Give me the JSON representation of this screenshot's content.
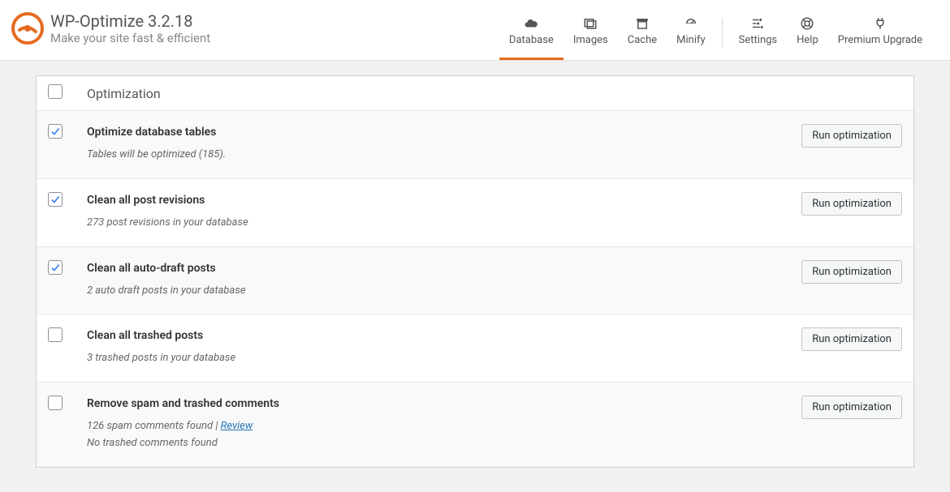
{
  "brand": {
    "title": "WP-Optimize 3.2.18",
    "tagline": "Make your site fast & efficient"
  },
  "nav": {
    "database": "Database",
    "images": "Images",
    "cache": "Cache",
    "minify": "Minify",
    "settings": "Settings",
    "help": "Help",
    "premium": "Premium Upgrade"
  },
  "table": {
    "header": "Optimization",
    "run_label": "Run optimization",
    "review_label": "Review",
    "rows": [
      {
        "title": "Optimize database tables",
        "desc": "Tables will be optimized (185).",
        "checked": true
      },
      {
        "title": "Clean all post revisions",
        "desc": "273 post revisions in your database",
        "checked": true
      },
      {
        "title": "Clean all auto-draft posts",
        "desc": "2 auto draft posts in your database",
        "checked": true
      },
      {
        "title": "Clean all trashed posts",
        "desc": "3 trashed posts in your database",
        "checked": false
      },
      {
        "title": "Remove spam and trashed comments",
        "desc": "126 spam comments found | ",
        "desc2": "No trashed comments found",
        "checked": false,
        "has_review": true
      }
    ]
  }
}
